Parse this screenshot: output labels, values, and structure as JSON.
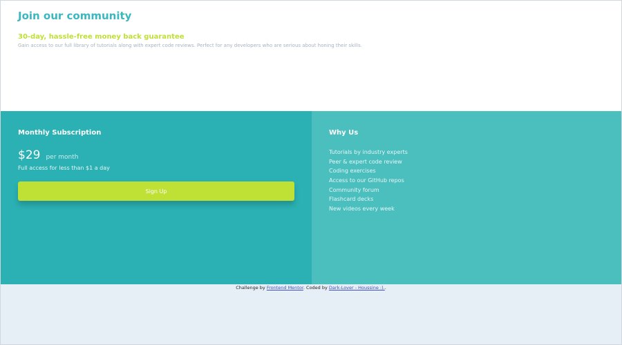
{
  "header": {
    "title": "Join our community",
    "subtitle": "30-day, hassle-free money back guarantee",
    "description": "Gain access to our full library of tutorials along with expert code reviews. Perfect for any developers who are serious about honing their skills."
  },
  "subscription": {
    "title": "Monthly Subscription",
    "price": "$29",
    "period": "per month",
    "note": "Full access for less than $1 a day",
    "button_label": "Sign Up"
  },
  "why_us": {
    "title": "Why Us",
    "items": [
      "Tutorials by industry experts",
      "Peer & expert code review",
      "Coding exercises",
      "Access to our GitHub repos",
      "Community forum",
      "Flashcard decks",
      "New videos every week"
    ]
  },
  "attribution": {
    "prefix": "Challenge by ",
    "challenge_link": "Frontend Mentor",
    "middle": ". Coded by ",
    "author_link": "Dark-Lover - Houssine :).",
    "suffix": "."
  },
  "colors": {
    "accent_cyan": "#3bb8bd",
    "accent_lime": "#bfe034",
    "panel_dark": "#2bb1b3",
    "panel_light": "#4bbebe",
    "page_bg": "#e6eef6"
  }
}
